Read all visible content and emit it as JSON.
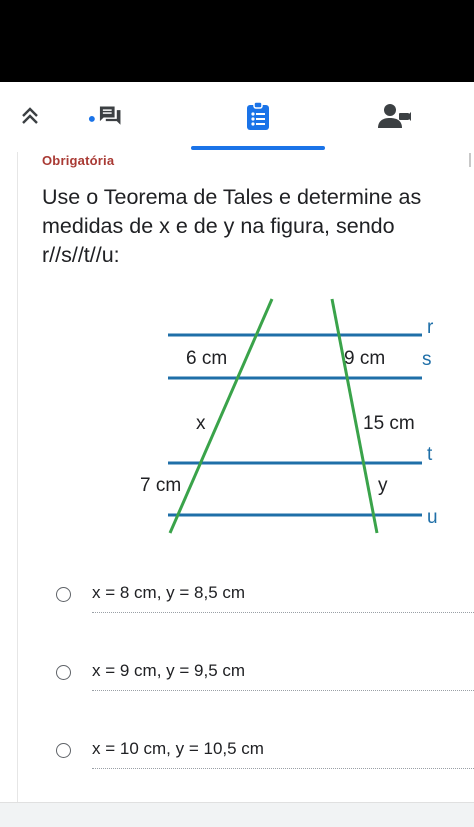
{
  "toolbar": {
    "icons": [
      "double-chevron-up-icon",
      "chat-icon",
      "assignment-icon",
      "person-add-icon"
    ],
    "active_tab": "assignment-icon",
    "accent": "#1a73e8",
    "notification_dot_color": "#1a73e8"
  },
  "question": {
    "required_label": "Obrigatória",
    "required_color": "#a93a34",
    "text_lines": [
      "Use o Teorema de Tales e determine as",
      "medidas de x e de y na figura, sendo",
      "r//s//t//u:"
    ]
  },
  "figure": {
    "parallel_line_color": "#1f6fa8",
    "transversal_color": "#3aa34a",
    "line_labels": {
      "r": "r",
      "s": "s",
      "t": "t",
      "u": "u"
    },
    "segment_labels": {
      "left_top": "6 cm",
      "right_top": "9 cm",
      "left_middle": "x",
      "right_middle": "15 cm",
      "left_bottom": "7 cm",
      "right_bottom": "y"
    }
  },
  "options": [
    {
      "label": "x = 8 cm, y = 8,5 cm"
    },
    {
      "label": "x = 9 cm, y = 9,5 cm"
    },
    {
      "label": "x = 10 cm, y = 10,5 cm"
    }
  ]
}
